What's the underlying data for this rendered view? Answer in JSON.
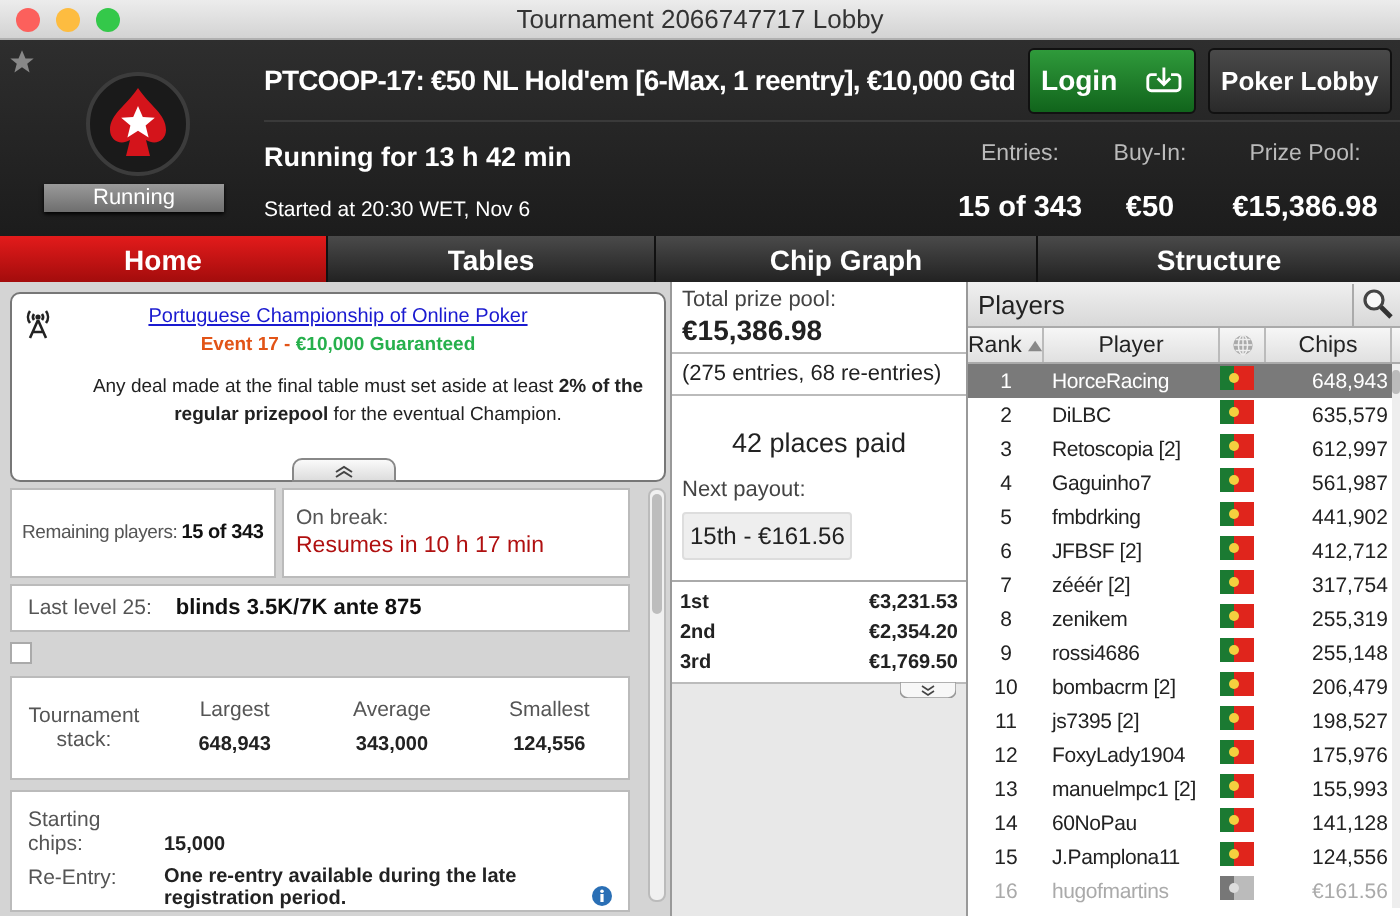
{
  "window": {
    "title": "Tournament 2066747717 Lobby"
  },
  "header": {
    "title": "PTCOOP-17: €50 NL Hold'em [6-Max, 1 reentry], €10,000 Gtd",
    "status": "Running",
    "running_for": "Running for 13 h 42 min",
    "started": "Started at 20:30 WET, Nov 6",
    "buttons": [
      {
        "kind": "login",
        "label": "Login"
      },
      {
        "kind": "plain",
        "label": "Poker Lobby"
      }
    ],
    "stats": [
      {
        "label": "Entries:",
        "value": "15 of 343"
      },
      {
        "label": "Buy-In:",
        "value": "€50"
      },
      {
        "label": "Prize Pool:",
        "value": "€15,386.98"
      }
    ]
  },
  "tabs": [
    {
      "label": "Home",
      "selected": true
    },
    {
      "label": "Tables",
      "selected": false
    },
    {
      "label": "Chip Graph",
      "selected": false
    },
    {
      "label": "Structure",
      "selected": false
    }
  ],
  "home": {
    "notice": {
      "link": "Portuguese Championship of Online Poker",
      "event": "Event 17",
      "separator": " - ",
      "guarantee": "€10,000 Guaranteed",
      "message": "Any deal made at the final table must set aside at least **2% of the regular prizepool** for the eventual Champion."
    },
    "remaining": {
      "label": "Remaining players:",
      "value": "15 of 343"
    },
    "break": {
      "label": "On break:",
      "value": "Resumes in 10 h 17 min"
    },
    "last_level": {
      "label": "Last level 25:",
      "value": "blinds 3.5K/7K ante 875"
    },
    "checkbox": {
      "checked": false
    },
    "stack": {
      "label": "Tournament stack:",
      "columns": [
        {
          "label": "Largest",
          "value": "648,943"
        },
        {
          "label": "Average",
          "value": "343,000"
        },
        {
          "label": "Smallest",
          "value": "124,556"
        }
      ]
    },
    "info": [
      {
        "label": "Starting chips:",
        "value": "15,000"
      },
      {
        "label": "Re-Entry:",
        "value": "One re-entry available during the late registration period."
      }
    ]
  },
  "prizes": {
    "total_label": "Total prize pool:",
    "total": "€15,386.98",
    "entries": "(275 entries, 68 re-entries)",
    "places_paid": "42 places paid",
    "next_label": "Next payout:",
    "next": "15th - €161.56",
    "payouts": [
      {
        "place": "1st",
        "amount": "€3,231.53"
      },
      {
        "place": "2nd",
        "amount": "€2,354.20"
      },
      {
        "place": "3rd",
        "amount": "€1,769.50"
      }
    ]
  },
  "players": {
    "title": "Players",
    "columns": [
      "Rank",
      "Player",
      "Chips"
    ],
    "rows": [
      {
        "rank": "1",
        "name": "HorceRacing",
        "chips": "648,943",
        "selected": true,
        "eliminated": false
      },
      {
        "rank": "2",
        "name": "DiLBC",
        "chips": "635,579",
        "selected": false,
        "eliminated": false
      },
      {
        "rank": "3",
        "name": "Retoscopia [2]",
        "chips": "612,997",
        "selected": false,
        "eliminated": false
      },
      {
        "rank": "4",
        "name": "Gaguinho7",
        "chips": "561,987",
        "selected": false,
        "eliminated": false
      },
      {
        "rank": "5",
        "name": "fmbdrking",
        "chips": "441,902",
        "selected": false,
        "eliminated": false
      },
      {
        "rank": "6",
        "name": "JFBSF [2]",
        "chips": "412,712",
        "selected": false,
        "eliminated": false
      },
      {
        "rank": "7",
        "name": "zééér [2]",
        "chips": "317,754",
        "selected": false,
        "eliminated": false
      },
      {
        "rank": "8",
        "name": "zenikem",
        "chips": "255,319",
        "selected": false,
        "eliminated": false
      },
      {
        "rank": "9",
        "name": "rossi4686",
        "chips": "255,148",
        "selected": false,
        "eliminated": false
      },
      {
        "rank": "10",
        "name": "bombacrm [2]",
        "chips": "206,479",
        "selected": false,
        "eliminated": false
      },
      {
        "rank": "11",
        "name": "js7395 [2]",
        "chips": "198,527",
        "selected": false,
        "eliminated": false
      },
      {
        "rank": "12",
        "name": "FoxyLady1904",
        "chips": "175,976",
        "selected": false,
        "eliminated": false
      },
      {
        "rank": "13",
        "name": "manuelmpc1 [2]",
        "chips": "155,993",
        "selected": false,
        "eliminated": false
      },
      {
        "rank": "14",
        "name": "60NoPau",
        "chips": "141,128",
        "selected": false,
        "eliminated": false
      },
      {
        "rank": "15",
        "name": "J.Pamplona11",
        "chips": "124,556",
        "selected": false,
        "eliminated": false
      },
      {
        "rank": "16",
        "name": "hugofmartins",
        "chips": "€161.56",
        "selected": false,
        "eliminated": true
      }
    ]
  }
}
